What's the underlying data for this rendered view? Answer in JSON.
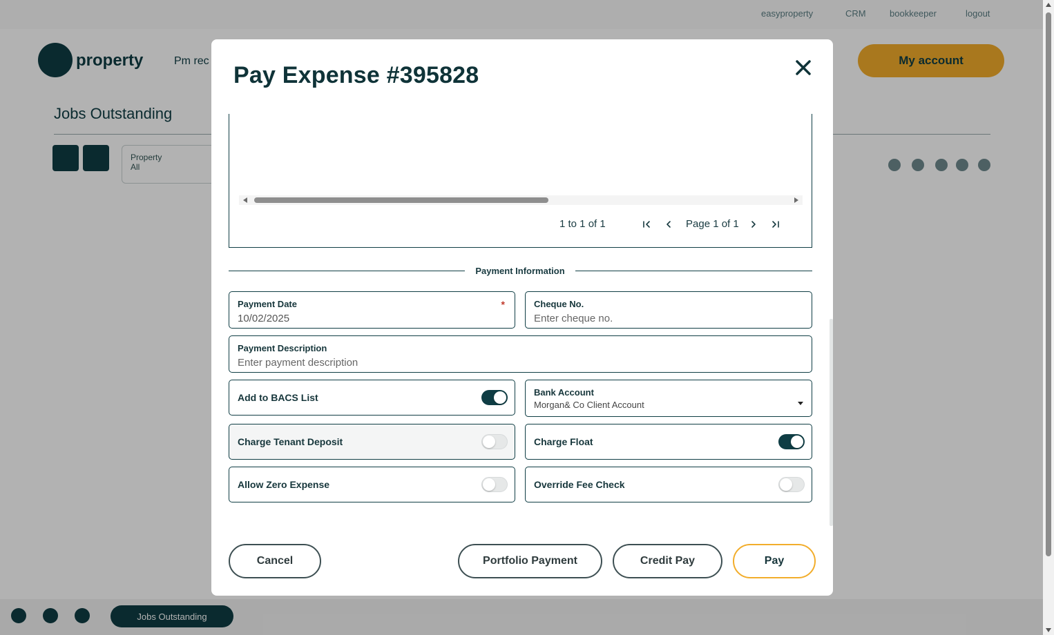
{
  "background": {
    "top_links": [
      "easyproperty",
      "CRM",
      "bookkeeper",
      "logout"
    ],
    "logo_text": "property",
    "nav_item": "Pm rec",
    "account_button": "My account",
    "page_heading": "Jobs Outstanding",
    "filter_label": "Property",
    "filter_value": "All",
    "bottom_chip": "Jobs Outstanding"
  },
  "modal": {
    "title": "Pay Expense #395828",
    "close_icon": "close-icon"
  },
  "grid": {
    "summary": "1 to 1 of 1",
    "page_label": "Page 1 of 1",
    "icons": [
      "first-page-icon",
      "prev-page-icon",
      "next-page-icon",
      "last-page-icon"
    ]
  },
  "payment_info": {
    "section_label": "Payment Information",
    "payment_date": {
      "label": "Payment Date",
      "value": "10/02/2025",
      "required_mark": "*"
    },
    "cheque_no": {
      "label": "Cheque No.",
      "placeholder": "Enter cheque no."
    },
    "payment_description": {
      "label": "Payment Description",
      "placeholder": "Enter payment description"
    },
    "add_to_bacs": {
      "label": "Add to BACS List",
      "on": true
    },
    "bank_account": {
      "label": "Bank Account",
      "value": "Morgan& Co Client Account"
    },
    "charge_tenant_deposit": {
      "label": "Charge Tenant Deposit",
      "on": false
    },
    "charge_float": {
      "label": "Charge Float",
      "on": true
    },
    "allow_zero_expense": {
      "label": "Allow Zero Expense",
      "on": false
    },
    "override_fee_check": {
      "label": "Override Fee Check",
      "on": false
    }
  },
  "footer": {
    "cancel": "Cancel",
    "portfolio_payment": "Portfolio Payment",
    "credit_pay": "Credit Pay",
    "pay": "Pay"
  },
  "colors": {
    "brand_dark": "#0f3d44",
    "accent": "#f2ad2b",
    "required": "#c0392b"
  }
}
